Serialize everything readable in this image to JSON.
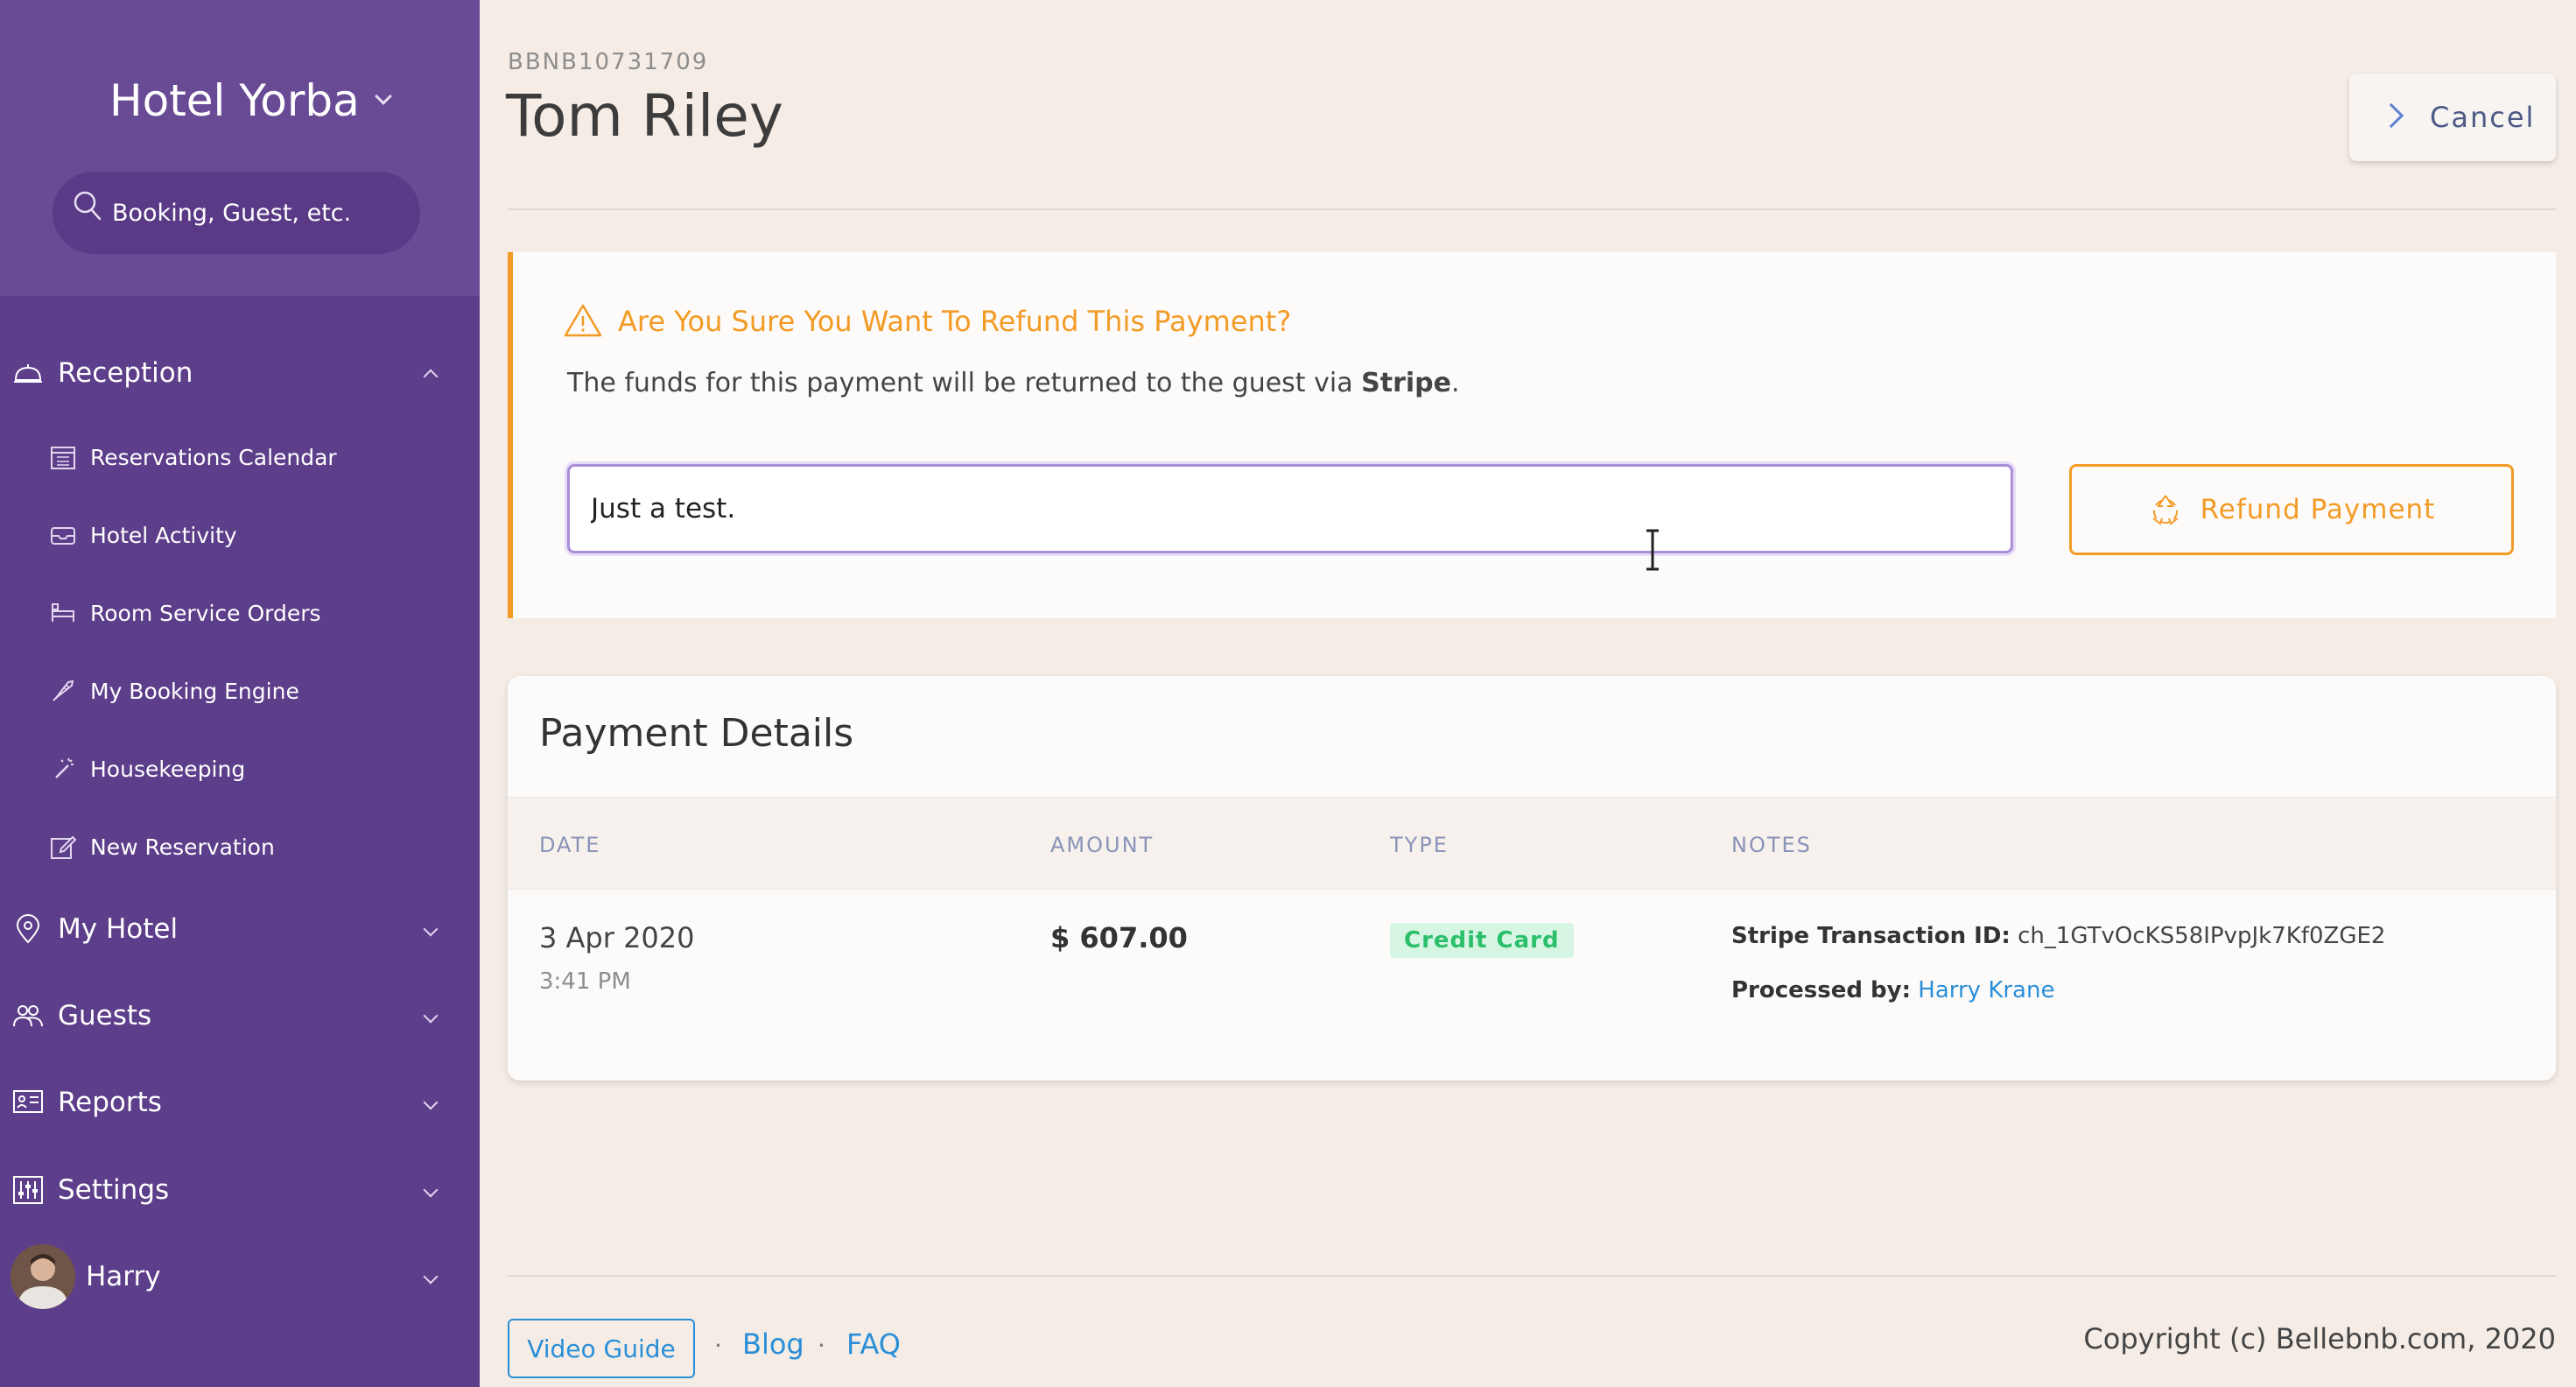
{
  "sidebar": {
    "hotel_name": "Hotel Yorba",
    "search_placeholder": "Booking, Guest, etc.",
    "sections": {
      "reception": "Reception",
      "my_hotel": "My Hotel",
      "guests": "Guests",
      "reports": "Reports",
      "settings": "Settings",
      "user": "Harry"
    },
    "reception_items": [
      "Reservations Calendar",
      "Hotel Activity",
      "Room Service Orders",
      "My Booking Engine",
      "Housekeeping",
      "New Reservation"
    ],
    "colors": {
      "background": "#5d3e8a",
      "header": "#694b95"
    }
  },
  "header": {
    "booking_ref": "BBNB10731709",
    "guest_name": "Tom Riley",
    "cancel_label": "Cancel"
  },
  "refund_confirm": {
    "title": "Are You Sure You Want To Refund This Payment?",
    "description_prefix": "The funds for this payment will be returned to the guest via ",
    "provider": "Stripe",
    "description_suffix": ".",
    "reason_value": "Just a test.",
    "refund_button_label": "Refund Payment",
    "accent_color": "#f29b26"
  },
  "payment_details": {
    "title": "Payment Details",
    "columns": [
      "DATE",
      "AMOUNT",
      "TYPE",
      "NOTES"
    ],
    "row": {
      "date": "3 Apr 2020",
      "time": "3:41 PM",
      "amount": "$ 607.00",
      "type": "Credit Card",
      "stripe_label": "Stripe Transaction ID:",
      "stripe_id": "ch_1GTvOcKS58IPvpJk7Kf0ZGE2",
      "processed_label": "Processed by:",
      "processed_by": "Harry Krane"
    }
  },
  "footer": {
    "video_guide": "Video Guide",
    "blog": "Blog",
    "faq": "FAQ",
    "separator": "·",
    "copyright": "Copyright (c) Bellebnb.com, 2020"
  }
}
